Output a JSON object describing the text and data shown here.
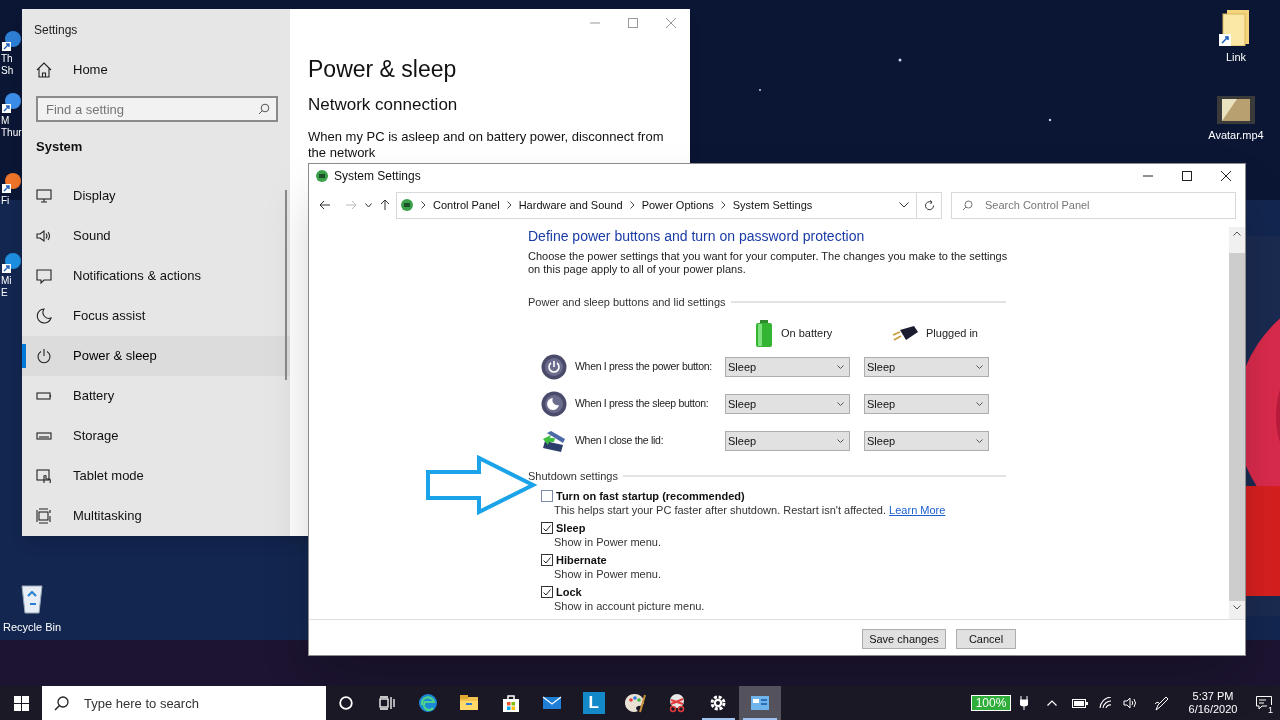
{
  "desktop": {
    "left_shortcuts": [
      {
        "kind": "pc",
        "label": "Th\nSh"
      },
      {
        "kind": "mail",
        "label": "M\nThur"
      },
      {
        "kind": "fox",
        "label": "Fi"
      },
      {
        "kind": "edge",
        "label": "Mi\nE"
      }
    ],
    "recycle_bin": {
      "label": "Recycle Bin"
    },
    "right_icons": [
      {
        "kind": "folder",
        "label": "Link"
      },
      {
        "kind": "video",
        "label": "Avatar.mp4"
      }
    ]
  },
  "settings_window": {
    "title": "Settings",
    "sidebar": {
      "home": "Home",
      "search_placeholder": "Find a setting",
      "section": "System",
      "items": [
        {
          "kind": "display",
          "label": "Display",
          "selected": false
        },
        {
          "kind": "sound",
          "label": "Sound",
          "selected": false
        },
        {
          "kind": "notifications",
          "label": "Notifications & actions",
          "selected": false
        },
        {
          "kind": "focus",
          "label": "Focus assist",
          "selected": false
        },
        {
          "kind": "power",
          "label": "Power & sleep",
          "selected": true
        },
        {
          "kind": "battery",
          "label": "Battery",
          "selected": false
        },
        {
          "kind": "storage",
          "label": "Storage",
          "selected": false
        },
        {
          "kind": "tablet",
          "label": "Tablet mode",
          "selected": false
        },
        {
          "kind": "multitasking",
          "label": "Multitasking",
          "selected": false
        }
      ]
    },
    "page_title": "Power & sleep",
    "subheading": "Network connection",
    "body": "When my PC is asleep and on battery power, disconnect from the network"
  },
  "control_panel": {
    "title": "System Settings",
    "breadcrumbs": [
      "Control Panel",
      "Hardware and Sound",
      "Power Options",
      "System Settings"
    ],
    "search_placeholder": "Search Control Panel",
    "heading": "Define power buttons and turn on password protection",
    "description": "Choose the power settings that you want for your computer. The changes you make to the settings on this page apply to all of your power plans.",
    "power_section": {
      "title": "Power and sleep buttons and lid settings",
      "columns": [
        "On battery",
        "Plugged in"
      ],
      "rows": [
        {
          "kind": "power",
          "label": "When I press the power button:",
          "on_battery": "Sleep",
          "plugged_in": "Sleep"
        },
        {
          "kind": "sleep",
          "label": "When I press the sleep button:",
          "on_battery": "Sleep",
          "plugged_in": "Sleep"
        },
        {
          "kind": "lid",
          "label": "When I close the lid:",
          "on_battery": "Sleep",
          "plugged_in": "Sleep"
        }
      ]
    },
    "shutdown_section": {
      "title": "Shutdown settings",
      "options": [
        {
          "label": "Turn on fast startup (recommended)",
          "description": "This helps start your PC faster after shutdown. Restart isn't affected.",
          "link": "Learn More",
          "checked": false
        },
        {
          "label": "Sleep",
          "description": "Show in Power menu.",
          "checked": true
        },
        {
          "label": "Hibernate",
          "description": "Show in Power menu.",
          "checked": true
        },
        {
          "label": "Lock",
          "description": "Show in account picture menu.",
          "checked": true
        }
      ]
    },
    "buttons": [
      "Save changes",
      "Cancel"
    ]
  },
  "taskbar": {
    "search_placeholder": "Type here to search",
    "apps": [
      {
        "kind": "edge",
        "active": false,
        "running": false
      },
      {
        "kind": "files",
        "active": false,
        "running": false
      },
      {
        "kind": "store",
        "active": false,
        "running": false
      },
      {
        "kind": "mail",
        "active": false,
        "running": false
      },
      {
        "kind": "letter",
        "glyph": "L",
        "active": false,
        "running": false
      },
      {
        "kind": "paint",
        "active": false,
        "running": false
      },
      {
        "kind": "snip",
        "active": false,
        "running": false
      },
      {
        "kind": "settings",
        "active": false,
        "running": true
      },
      {
        "kind": "control_panel",
        "active": true,
        "running": true
      }
    ],
    "tray": {
      "battery": "100%",
      "time": "5:37 PM",
      "date": "6/16/2020",
      "notifications": "1"
    }
  }
}
